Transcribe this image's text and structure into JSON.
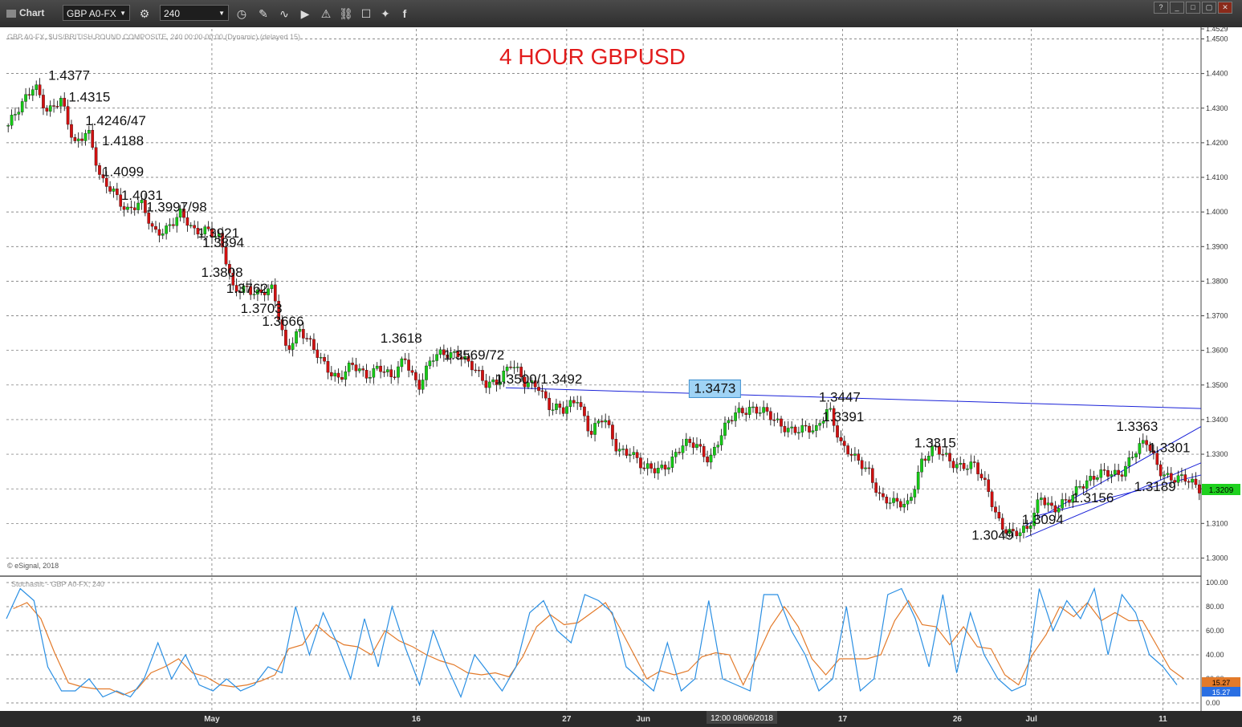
{
  "toolbar": {
    "title": "Chart",
    "symbol": "GBP A0-FX",
    "interval": "240"
  },
  "chart_data": {
    "type": "candlestick",
    "title": "4 HOUR GBPUSD",
    "legend_text": "GBP A0-FX, $US/BRITISH POUND COMPOSITE, 240 00:00-00:00 (Dynamic) (delayed 15)",
    "copyright": "© eSignal, 2018",
    "current_price": "1.3209",
    "ylim": [
      1.295,
      1.4529
    ],
    "y_ticks": [
      "1.4529",
      "1.4500",
      "1.4400",
      "1.4300",
      "1.4200",
      "1.4100",
      "1.4000",
      "1.3900",
      "1.3800",
      "1.3700",
      "1.3600",
      "1.3500",
      "1.3400",
      "1.3300",
      "1.3200",
      "1.3100",
      "1.3000"
    ],
    "x_labels": [
      "May",
      "16",
      "27",
      "Jun",
      "17",
      "26",
      "Jul",
      "11"
    ],
    "crosshair_time": "12:00 08/06/2018",
    "price_path": [
      1.425,
      1.43,
      1.4377,
      1.429,
      1.4315,
      1.42,
      1.4246,
      1.408,
      1.406,
      1.401,
      1.402,
      1.394,
      1.396,
      1.399,
      1.394,
      1.396,
      1.392,
      1.377,
      1.379,
      1.376,
      1.377,
      1.361,
      1.366,
      1.36,
      1.356,
      1.352,
      1.355,
      1.353,
      1.356,
      1.351,
      1.358,
      1.35,
      1.357,
      1.359,
      1.36,
      1.355,
      1.35,
      1.352,
      1.356,
      1.35,
      1.351,
      1.343,
      1.342,
      1.347,
      1.336,
      1.34,
      1.332,
      1.331,
      1.325,
      1.326,
      1.328,
      1.332,
      1.333,
      1.329,
      1.336,
      1.342,
      1.344,
      1.342,
      1.339,
      1.338,
      1.337,
      1.336,
      1.3447,
      1.332,
      1.328,
      1.326,
      1.317,
      1.315,
      1.316,
      1.328,
      1.331,
      1.329,
      1.327,
      1.326,
      1.32,
      1.31,
      1.306,
      1.308,
      1.319,
      1.313,
      1.316,
      1.322,
      1.323,
      1.324,
      1.325,
      1.33,
      1.333,
      1.326,
      1.323,
      1.322,
      1.3205
    ],
    "levels": [
      {
        "label": "1.4377",
        "d": 0.035,
        "p": 1.4377
      },
      {
        "label": "1.4315",
        "d": 0.052,
        "p": 1.4315
      },
      {
        "label": "1.4246/47",
        "d": 0.066,
        "p": 1.4246
      },
      {
        "label": "1.4188",
        "d": 0.08,
        "p": 1.4188
      },
      {
        "label": "1.4099",
        "d": 0.08,
        "p": 1.4099
      },
      {
        "label": "1.4031",
        "d": 0.096,
        "p": 1.4031
      },
      {
        "label": "1.3997/98",
        "d": 0.117,
        "p": 1.3997
      },
      {
        "label": "1.3921",
        "d": 0.16,
        "p": 1.3921
      },
      {
        "label": "1.3894",
        "d": 0.164,
        "p": 1.3894
      },
      {
        "label": "1.3808",
        "d": 0.163,
        "p": 1.3808
      },
      {
        "label": "1.3762",
        "d": 0.184,
        "p": 1.3762
      },
      {
        "label": "1.3703",
        "d": 0.196,
        "p": 1.3703
      },
      {
        "label": "1.3666",
        "d": 0.214,
        "p": 1.3666
      },
      {
        "label": "1.3618",
        "d": 0.313,
        "p": 1.3618
      },
      {
        "label": "1.3569/72",
        "d": 0.366,
        "p": 1.3569
      },
      {
        "label": "1.3500/1.3492",
        "d": 0.409,
        "p": 1.35
      },
      {
        "label": "1.3473",
        "d": 0.593,
        "p": 1.3473,
        "boxed": true
      },
      {
        "label": "1.3447",
        "d": 0.68,
        "p": 1.3447
      },
      {
        "label": "1.3391",
        "d": 0.683,
        "p": 1.3391
      },
      {
        "label": "1.3315",
        "d": 0.76,
        "p": 1.3315
      },
      {
        "label": "1.3363",
        "d": 0.929,
        "p": 1.3363
      },
      {
        "label": "1.3301",
        "d": 0.956,
        "p": 1.3301
      },
      {
        "label": "1.3156",
        "d": 0.892,
        "p": 1.3156
      },
      {
        "label": "1.3189",
        "d": 0.944,
        "p": 1.3189
      },
      {
        "label": "1.3094",
        "d": 0.85,
        "p": 1.3094
      },
      {
        "label": "1.3049",
        "d": 0.808,
        "p": 1.3049
      }
    ],
    "trendlines": [
      {
        "from": [
          0.418,
          1.3492
        ],
        "to": [
          1.0,
          1.3432
        ]
      },
      {
        "from": [
          0.853,
          1.3094
        ],
        "to": [
          1.0,
          1.338
        ]
      },
      {
        "from": [
          0.853,
          1.306
        ],
        "to": [
          1.0,
          1.3275
        ]
      },
      {
        "from": [
          0.86,
          1.312
        ],
        "to": [
          1.0,
          1.324
        ]
      }
    ],
    "stochastic": {
      "label": "Stochastic - GBP A0-FX, 240",
      "ylim": [
        0,
        100
      ],
      "y_ticks": [
        "100.00",
        "80.00",
        "60.00",
        "40.00",
        "20.00",
        "0.00"
      ],
      "value_k": "15.27",
      "value_d": "15.27",
      "k": [
        70,
        95,
        85,
        30,
        10,
        10,
        20,
        5,
        10,
        5,
        20,
        50,
        20,
        40,
        15,
        10,
        20,
        10,
        15,
        30,
        25,
        80,
        40,
        75,
        50,
        20,
        70,
        30,
        80,
        45,
        15,
        60,
        30,
        5,
        40,
        25,
        10,
        30,
        75,
        85,
        60,
        50,
        90,
        85,
        75,
        30,
        20,
        10,
        50,
        10,
        20,
        85,
        20,
        15,
        10,
        90,
        90,
        60,
        40,
        10,
        20,
        80,
        10,
        20,
        90,
        95,
        70,
        30,
        90,
        25,
        75,
        40,
        20,
        10,
        15,
        95,
        60,
        85,
        70,
        95,
        40,
        90,
        75,
        40,
        30,
        15
      ]
    }
  }
}
